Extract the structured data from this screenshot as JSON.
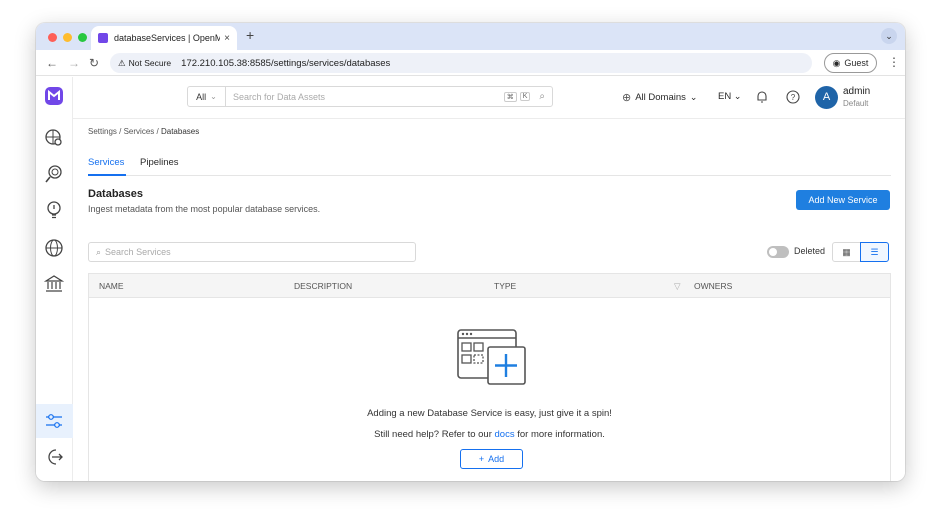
{
  "browser": {
    "tab_title": "databaseServices | OpenMet...",
    "tab_close": "×",
    "new_tab": "+",
    "not_secure": "Not Secure",
    "url": "172.210.105.38:8585/settings/services/databases",
    "guest_label": "Guest"
  },
  "topbar": {
    "search_scope": "All",
    "search_placeholder": "Search for Data Assets",
    "kbd_cmd": "⌘",
    "kbd_key": "K",
    "domains": "All Domains",
    "language": "EN",
    "user_initial": "A",
    "user_name": "admin",
    "user_role": "Default"
  },
  "breadcrumb": [
    "Settings",
    "Services",
    "Databases"
  ],
  "tabs": [
    "Services",
    "Pipelines"
  ],
  "page": {
    "title": "Databases",
    "subtitle": "Ingest metadata from the most popular database services.",
    "add_button": "Add New Service",
    "search_placeholder": "Search Services",
    "deleted_label": "Deleted"
  },
  "table": {
    "columns": [
      "NAME",
      "DESCRIPTION",
      "TYPE",
      "OWNERS"
    ]
  },
  "empty": {
    "line1": "Adding a new Database Service is easy, just give it a spin!",
    "line2_pre": "Still need help? Refer to our ",
    "line2_link": "docs",
    "line2_post": " for more information.",
    "add_label": "Add"
  },
  "colors": {
    "accent": "#1570ef",
    "primary_button": "#1f7fe0",
    "avatar": "#1f64a8",
    "logo": "#7147e8"
  }
}
